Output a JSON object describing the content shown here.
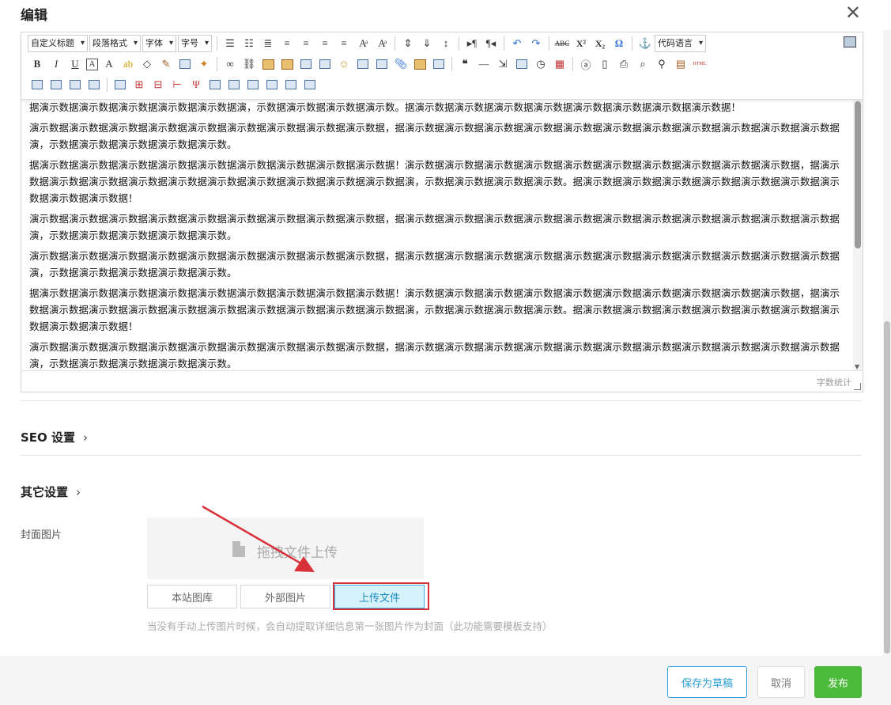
{
  "header": {
    "title": "编辑",
    "close_label": "✕"
  },
  "toolbar": {
    "combos": [
      "自定义标题",
      "段落格式",
      "字体",
      "字号"
    ],
    "code_language": "代码语言",
    "glyph_bold": "B",
    "glyph_italic": "I",
    "glyph_underline": "U",
    "glyph_a": "A",
    "glyph_superscript": "X²",
    "glyph_subscript": "X₂",
    "glyph_omega": "Ω",
    "glyph_abc": "ABC",
    "glyph_quote": "❝",
    "glyph_hr": "—",
    "glyph_html": "HTML",
    "glyph_undo": "↶",
    "glyph_redo": "↷"
  },
  "editor": {
    "paragraphs": [
      "据演示数据演示数据演示数据演示数据演示数据演，示数据演示数据演示数据演示数。据演示数据演示数据演示数据演示数据演示数据演示数据演示数据演示数据！",
      "演示数据演示数据演示数据演示数据演示数据演示数据演示数据演示数据演示数据，据演示数据演示数据演示数据演示数据演示数据演示数据演示数据演示数据演示数据演示数据演示数据演，示数据演示数据演示数据演示数据演示数。",
      "据演示数据演示数据演示数据演示数据演示数据演示数据演示数据演示数据演示数据！演示数据演示数据演示数据演示数据演示数据演示数据演示数据演示数据演示数据演示数据，据演示数据演示数据演示数据演示数据演示数据演示数据演示数据演示数据演示数据演示数据演，示数据演示数据演示数据演示数。据演示数据演示数据演示数据演示数据演示数据演示数据演示数据演示数据演示数据！",
      "演示数据演示数据演示数据演示数据演示数据演示数据演示数据演示数据演示数据，据演示数据演示数据演示数据演示数据演示数据演示数据演示数据演示数据演示数据演示数据演示数据演，示数据演示数据演示数据演示数据演示数。",
      "演示数据演示数据演示数据演示数据演示数据演示数据演示数据演示数据演示数据，据演示数据演示数据演示数据演示数据演示数据演示数据演示数据演示数据演示数据演示数据演示数据演，示数据演示数据演示数据演示数据演示数。",
      "据演示数据演示数据演示数据演示数据演示数据演示数据演示数据演示数据演示数据！演示数据演示数据演示数据演示数据演示数据演示数据演示数据演示数据演示数据演示数据，据演示数据演示数据演示数据演示数据演示数据演示数据演示数据演示数据演示数据演示数据演，示数据演示数据演示数据演示数。据演示数据演示数据演示数据演示数据演示数据演示数据演示数据演示数据演示数据！",
      "演示数据演示数据演示数据演示数据演示数据演示数据演示数据演示数据演示数据，据演示数据演示数据演示数据演示数据演示数据演示数据演示数据演示数据演示数据演示数据演示数据演，示数据演示数据演示数据演示数据演示数。"
    ],
    "word_count_label": "字数统计"
  },
  "sections": {
    "seo_title": "SEO 设置",
    "other_title": "其它设置",
    "chevron": "›"
  },
  "cover": {
    "label": "封面图片",
    "drop_text": "拖拽文件上传",
    "buttons": {
      "library": "本站图库",
      "external": "外部图片",
      "upload": "上传文件"
    },
    "hint": "当没有手动上传图片时候，会自动提取详细信息第一张图片作为封面（此功能需要模板支持）"
  },
  "footer": {
    "draft": "保存为草稿",
    "cancel": "取消",
    "publish": "发布"
  },
  "colors": {
    "publish": "#4cbb3c",
    "draft_border": "#2a9fd6",
    "highlight": "#d9313a",
    "upload_bg": "#d6f2fb"
  }
}
